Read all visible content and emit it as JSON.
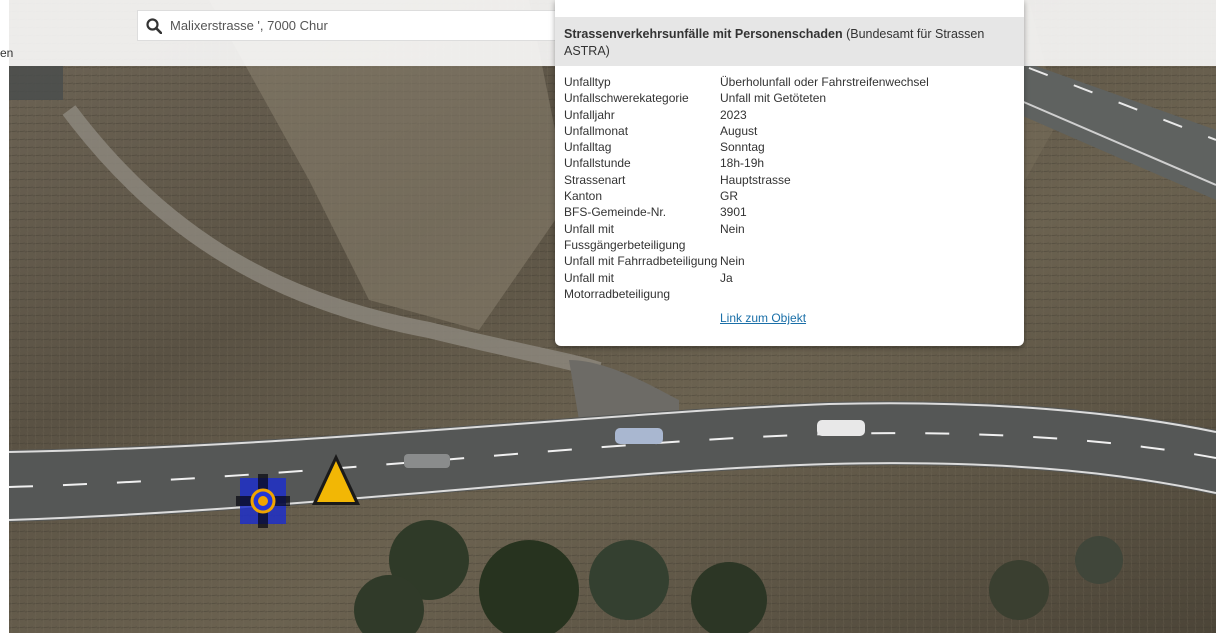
{
  "left_cut_text": "en",
  "search": {
    "value": "Malixerstrasse ', 7000 Chur",
    "icon": "search-icon"
  },
  "popup": {
    "title_bold": "Strassenverkehrsunfälle mit Personenschaden",
    "title_rest": " (Bundesamt für Strassen ASTRA)",
    "rows": [
      {
        "key": "Unfalltyp",
        "value": "Überholunfall oder Fahrstreifenwechsel"
      },
      {
        "key": "Unfallschwerekategorie",
        "value": "Unfall mit Getöteten"
      },
      {
        "key": "Unfalljahr",
        "value": "2023"
      },
      {
        "key": "Unfallmonat",
        "value": "August"
      },
      {
        "key": "Unfalltag",
        "value": "Sonntag"
      },
      {
        "key": "Unfallstunde",
        "value": "18h-19h"
      },
      {
        "key": "Strassenart",
        "value": "Hauptstrasse"
      },
      {
        "key": "Kanton",
        "value": "GR"
      },
      {
        "key": "BFS-Gemeinde-Nr.",
        "value": "3901"
      },
      {
        "key": "Unfall mit Fussgängerbeteiligung",
        "value": "Nein"
      },
      {
        "key": "Unfall mit Fahrradbeteiligung",
        "value": "Nein"
      },
      {
        "key": "Unfall mit Motorradbeteiligung",
        "value": "Ja"
      }
    ],
    "link_label": "Link zum Objekt"
  },
  "colors": {
    "link": "#1a6fa8",
    "marker_blue": "#2336d8",
    "marker_orange": "#f0a400",
    "warning_yellow": "#f2b705"
  }
}
